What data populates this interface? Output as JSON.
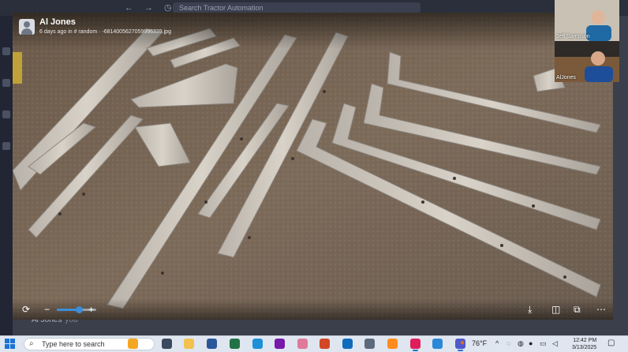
{
  "app": {
    "search_placeholder": "Search Tractor Automation",
    "nav": {
      "back": "←",
      "forward": "→",
      "history": "◷"
    },
    "composer": {
      "author": "Al Jones",
      "suffix": "you"
    }
  },
  "viewer": {
    "author": "Al Jones",
    "meta": "6 days ago in  # random  ·  -6814005627059996339.jpg",
    "footer": {
      "zoom_out": "−",
      "zoom_in": "+",
      "zoom_level": 0.55
    }
  },
  "call": {
    "participants": [
      {
        "name": "Jeff Sampson",
        "bg": "#c9c1b4",
        "shirt": "#1f6aa5"
      },
      {
        "name": "AlJones",
        "bg": "#7a5a3a",
        "shirt": "#1d4e9a"
      }
    ]
  },
  "taskbar": {
    "search_placeholder": "Type here to search",
    "weather": "76°F",
    "time": "12:42 PM",
    "date": "3/13/2025",
    "apps": [
      {
        "name": "copilot-icon",
        "color": "#f5a623"
      },
      {
        "name": "task-view-icon",
        "color": "#3b4a5e"
      },
      {
        "name": "file-explorer-icon",
        "color": "#f2c14e"
      },
      {
        "name": "word-icon",
        "color": "#2b579a"
      },
      {
        "name": "excel-icon",
        "color": "#217346"
      },
      {
        "name": "edge-icon",
        "color": "#1e90d6"
      },
      {
        "name": "onenote-icon",
        "color": "#7719aa"
      },
      {
        "name": "paint-icon",
        "color": "#e07a9a"
      },
      {
        "name": "powerpoint-icon",
        "color": "#d24726"
      },
      {
        "name": "outlook-icon",
        "color": "#0f6cbd"
      },
      {
        "name": "calculator-icon",
        "color": "#5b6b7d"
      },
      {
        "name": "sublime-icon",
        "color": "#ff8c1a"
      },
      {
        "name": "slack-icon",
        "color": "#e01e5a"
      },
      {
        "name": "snip-icon",
        "color": "#2b88d8"
      },
      {
        "name": "teams-icon",
        "color": "#5059c9"
      }
    ]
  }
}
